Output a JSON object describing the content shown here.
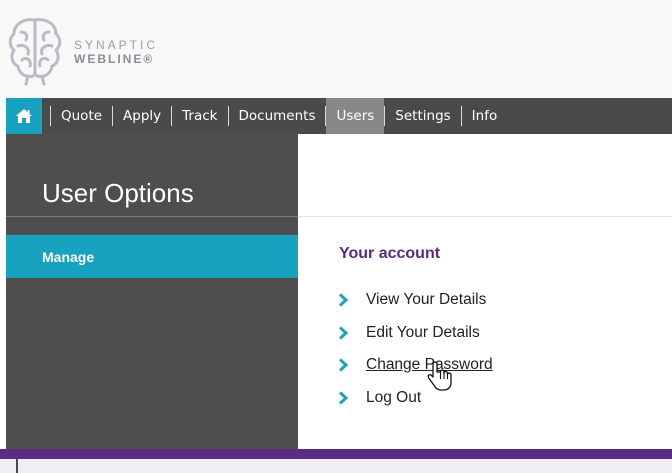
{
  "brand": {
    "line1": "SYNAPTIC",
    "line2": "WEBLINE®"
  },
  "nav": {
    "home_icon": "home-icon",
    "items": [
      "Quote",
      "Apply",
      "Track",
      "Documents",
      "Users",
      "Settings",
      "Info"
    ],
    "active": "Users"
  },
  "sidebar": {
    "title": "User Options",
    "items": [
      {
        "label": "Manage",
        "active": true
      }
    ]
  },
  "main": {
    "section_title": "Your account",
    "links": [
      {
        "label": "View Your Details"
      },
      {
        "label": "Edit Your Details"
      },
      {
        "label": "Change Password",
        "hover": true
      },
      {
        "label": "Log Out"
      }
    ]
  },
  "colors": {
    "accent": "#17a2c0",
    "nav_bg": "#4a4a4a",
    "sidebar_bg": "#4e4e4e",
    "purple": "#5a2d82"
  }
}
